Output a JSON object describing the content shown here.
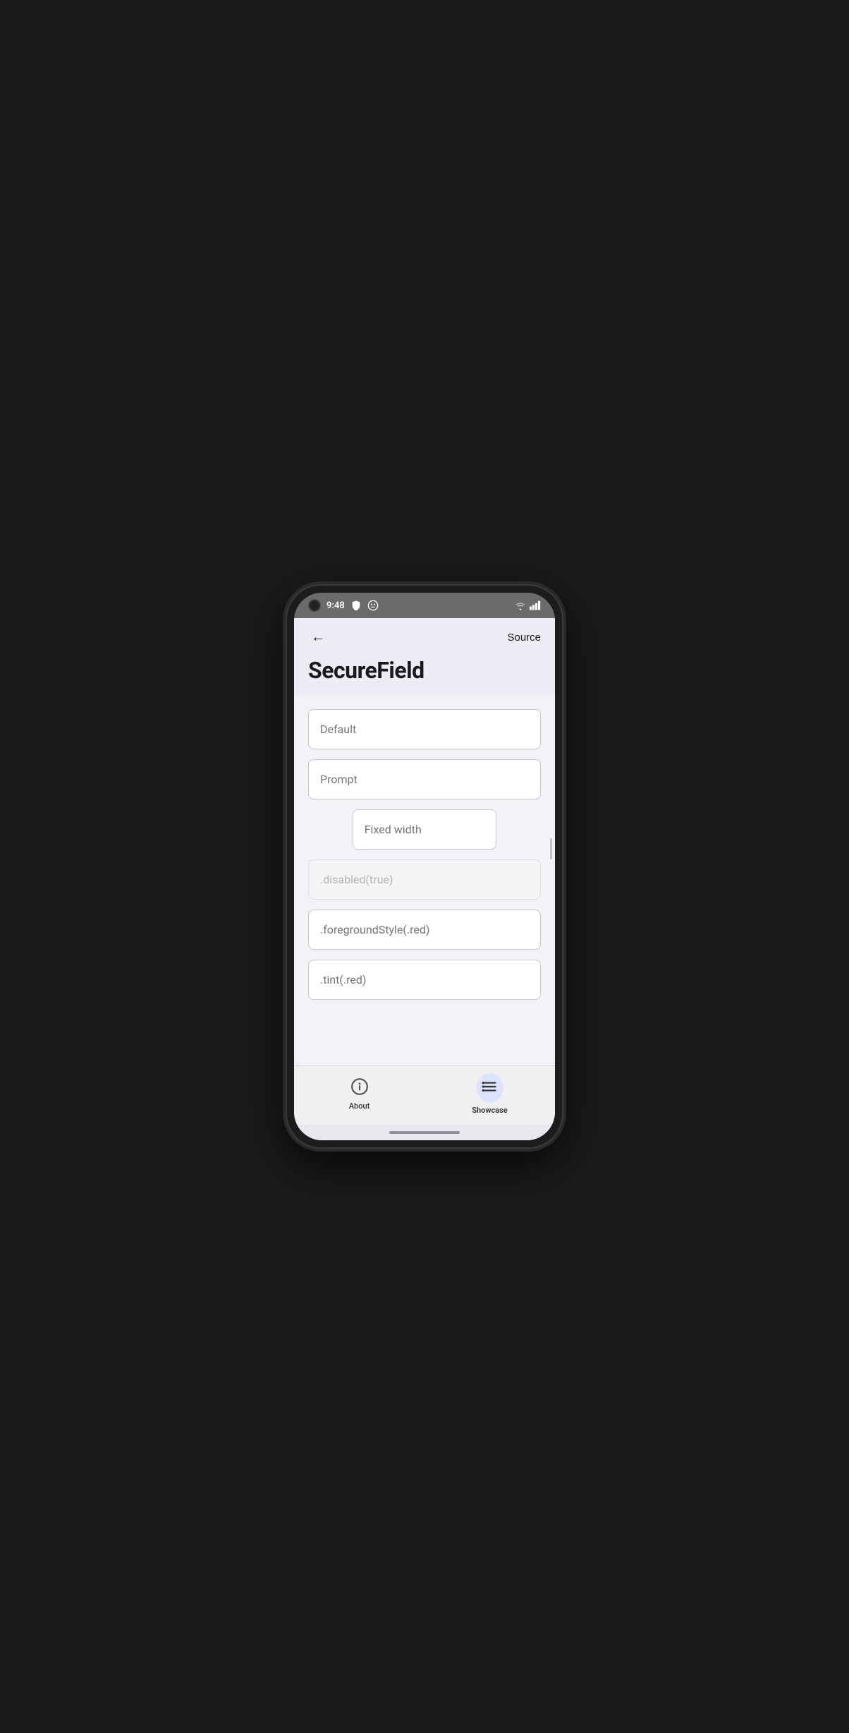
{
  "status_bar": {
    "time": "9:48",
    "wifi_label": "wifi",
    "signal_label": "signal"
  },
  "header": {
    "back_label": "←",
    "source_label": "Source",
    "title": "SecureField"
  },
  "fields": [
    {
      "id": "default-field",
      "placeholder": "Default",
      "disabled": false,
      "style": "normal"
    },
    {
      "id": "prompt-field",
      "placeholder": "Prompt",
      "disabled": false,
      "style": "normal"
    },
    {
      "id": "fixed-width-field",
      "placeholder": "Fixed width",
      "disabled": false,
      "style": "fixed-width"
    },
    {
      "id": "disabled-field",
      "placeholder": ".disabled(true)",
      "disabled": true,
      "style": "normal"
    },
    {
      "id": "foreground-field",
      "placeholder": ".foregroundStyle(.red)",
      "disabled": false,
      "style": "red-fg"
    },
    {
      "id": "tint-field",
      "placeholder": ".tint(.red)",
      "disabled": false,
      "style": "normal"
    }
  ],
  "tabs": [
    {
      "id": "about",
      "label": "About",
      "active": false,
      "icon": "info-circle"
    },
    {
      "id": "showcase",
      "label": "Showcase",
      "active": true,
      "icon": "list"
    }
  ]
}
